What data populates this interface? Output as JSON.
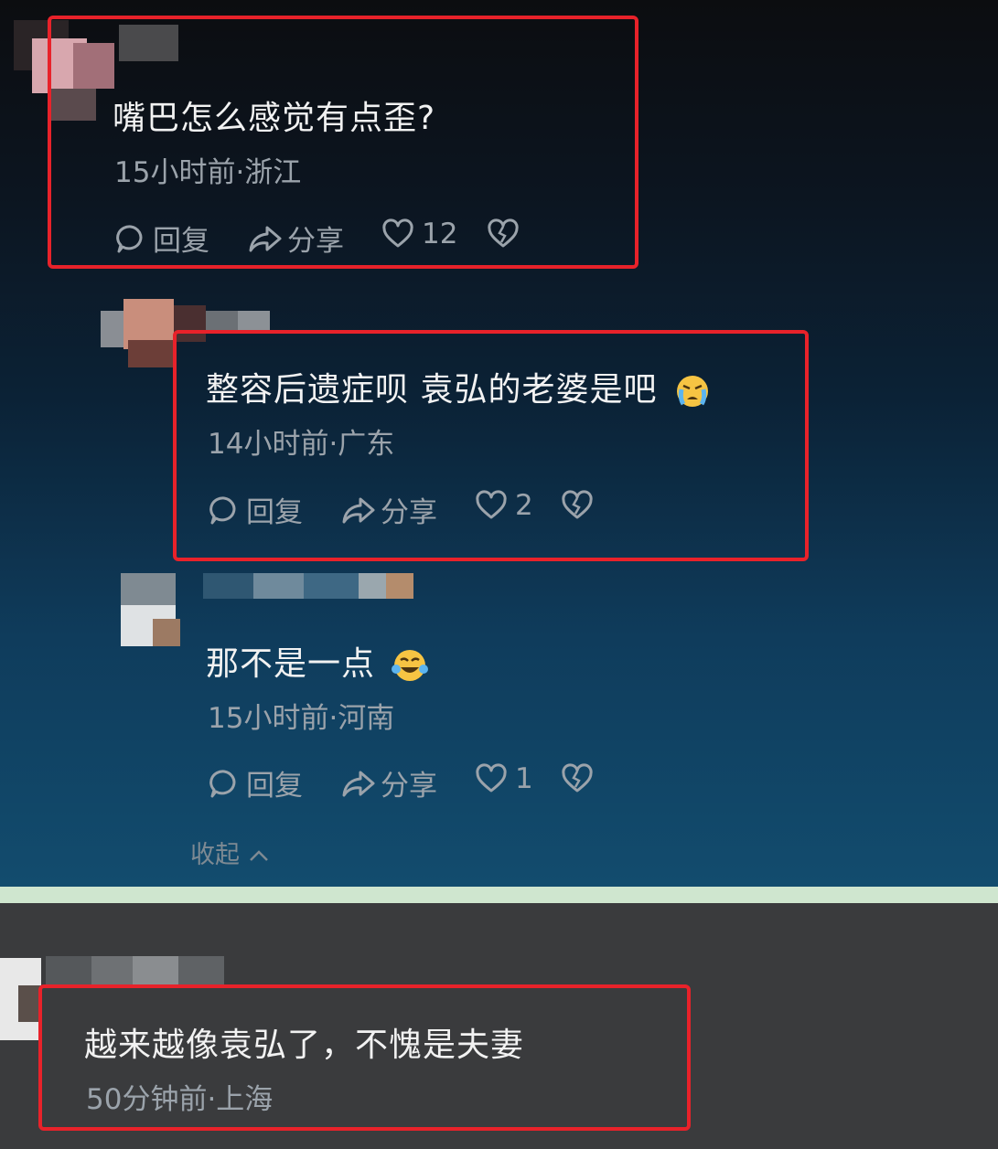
{
  "comments": [
    {
      "text": "嘴巴怎么感觉有点歪?",
      "meta": "15小时前·浙江",
      "reply": "回复",
      "share": "分享",
      "likes": "12"
    },
    {
      "text": "整容后遗症呗  袁弘的老婆是吧",
      "meta": "14小时前·广东",
      "reply": "回复",
      "share": "分享",
      "likes": "2",
      "emoji": "crying-face-emoji"
    },
    {
      "text": "那不是一点",
      "meta": "15小时前·河南",
      "reply": "回复",
      "share": "分享",
      "likes": "1",
      "emoji": "laughing-tears-emoji"
    },
    {
      "text": "越来越像袁弘了，不愧是夫妻",
      "meta": "50分钟前·上海"
    }
  ],
  "collapse_label": "收起",
  "icons": {
    "reply": "comment-bubble-icon",
    "share": "share-arrow-icon",
    "like": "heart-icon",
    "dislike": "broken-heart-icon",
    "collapse": "chevron-up-icon"
  },
  "colors": {
    "highlight_box": "#e8222a",
    "meta_text": "#9ba3ab",
    "text": "#f2f2f2"
  }
}
